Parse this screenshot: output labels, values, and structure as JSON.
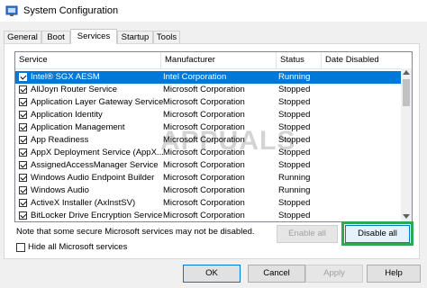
{
  "window": {
    "title": "System Configuration"
  },
  "tabs": [
    {
      "label": "General"
    },
    {
      "label": "Boot"
    },
    {
      "label": "Services",
      "active": true
    },
    {
      "label": "Startup"
    },
    {
      "label": "Tools"
    }
  ],
  "table": {
    "headers": [
      "Service",
      "Manufacturer",
      "Status",
      "Date Disabled"
    ],
    "rows": [
      {
        "service": "Intel® SGX AESM",
        "manufacturer": "Intel Corporation",
        "status": "Running",
        "checked": true,
        "selected": true
      },
      {
        "service": "AllJoyn Router Service",
        "manufacturer": "Microsoft Corporation",
        "status": "Stopped",
        "checked": true
      },
      {
        "service": "Application Layer Gateway Service",
        "manufacturer": "Microsoft Corporation",
        "status": "Stopped",
        "checked": true
      },
      {
        "service": "Application Identity",
        "manufacturer": "Microsoft Corporation",
        "status": "Stopped",
        "checked": true
      },
      {
        "service": "Application Management",
        "manufacturer": "Microsoft Corporation",
        "status": "Stopped",
        "checked": true
      },
      {
        "service": "App Readiness",
        "manufacturer": "Microsoft Corporation",
        "status": "Stopped",
        "checked": true
      },
      {
        "service": "AppX Deployment Service (AppX...",
        "manufacturer": "Microsoft Corporation",
        "status": "Stopped",
        "checked": true
      },
      {
        "service": "AssignedAccessManager Service",
        "manufacturer": "Microsoft Corporation",
        "status": "Stopped",
        "checked": true
      },
      {
        "service": "Windows Audio Endpoint Builder",
        "manufacturer": "Microsoft Corporation",
        "status": "Running",
        "checked": true
      },
      {
        "service": "Windows Audio",
        "manufacturer": "Microsoft Corporation",
        "status": "Running",
        "checked": true
      },
      {
        "service": "ActiveX Installer (AxInstSV)",
        "manufacturer": "Microsoft Corporation",
        "status": "Stopped",
        "checked": true
      },
      {
        "service": "BitLocker Drive Encryption Service",
        "manufacturer": "Microsoft Corporation",
        "status": "Stopped",
        "checked": true
      }
    ]
  },
  "note": "Note that some secure Microsoft services may not be disabled.",
  "buttons": {
    "enable_all": "Enable all",
    "disable_all": "Disable all",
    "ok": "OK",
    "cancel": "Cancel",
    "apply": "Apply",
    "help": "Help"
  },
  "hide_ms": {
    "label": "Hide all Microsoft services",
    "checked": false
  },
  "watermark": "APPUALS",
  "colors": {
    "selection": "#0078d7",
    "highlight_box": "#2fa84f"
  },
  "icons": {
    "app": "system-config-icon"
  }
}
